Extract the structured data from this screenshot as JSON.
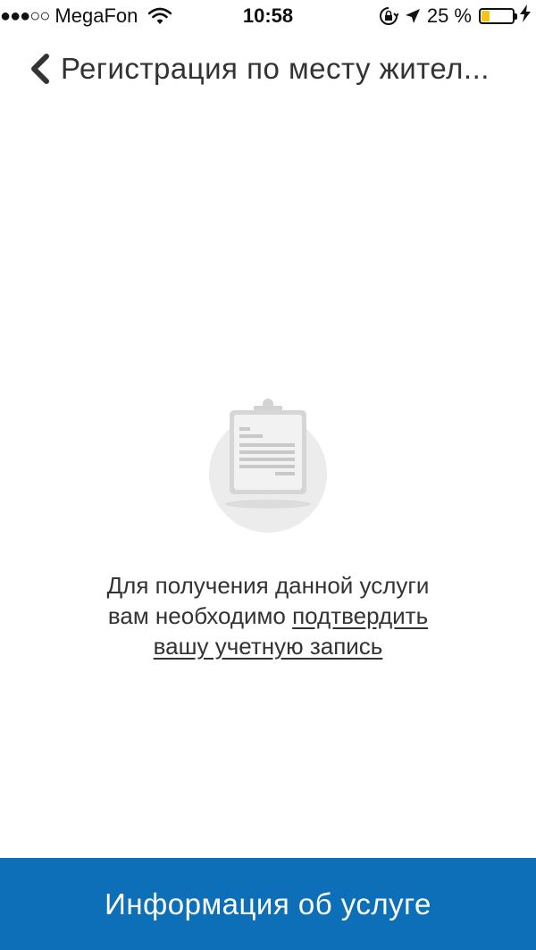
{
  "status_bar": {
    "signal": "●●●○○",
    "carrier": "MegaFon",
    "time": "10:58",
    "battery_percent": "25 %",
    "battery_level": 0.25,
    "wifi_icon": "wifi-icon",
    "lock_icon": "orientation-lock-icon",
    "location_icon": "location-arrow-icon",
    "charging_icon": "bolt-icon"
  },
  "nav": {
    "back_icon": "chevron-left-icon",
    "title": "Регистрация по месту жител..."
  },
  "empty_state": {
    "icon": "clipboard-document-icon",
    "line1": "Для получения данной услуги",
    "line2_prefix": "вам необходимо ",
    "link_part1": "подтвердить",
    "link_part2": "вашу учетную запись"
  },
  "bottom_button": {
    "label": "Информация об услуге",
    "color": "#0d6fb8"
  }
}
